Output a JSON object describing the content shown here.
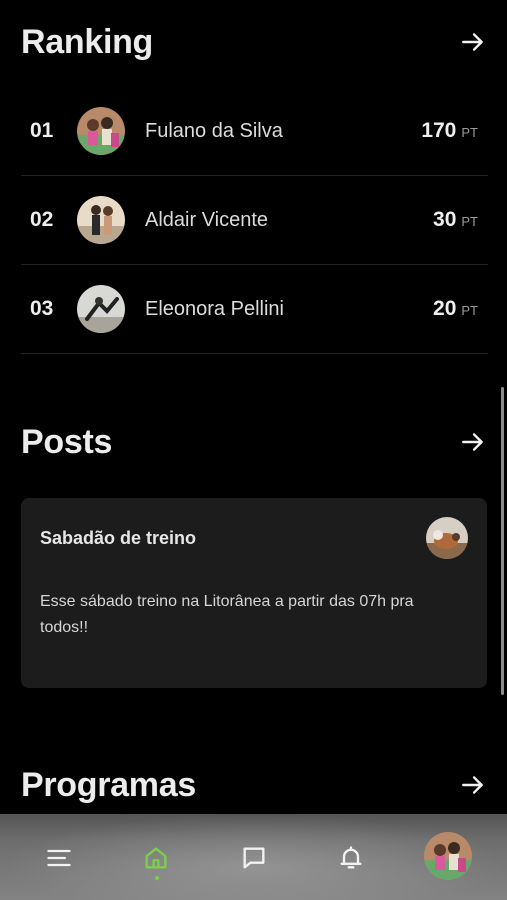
{
  "ranking": {
    "title": "Ranking",
    "unit": "PT",
    "entries": [
      {
        "position": "01",
        "name": "Fulano da Silva",
        "points": "170",
        "avatar": "photo-group-avatar"
      },
      {
        "position": "02",
        "name": "Aldair Vicente",
        "points": "30",
        "avatar": "photo-duo-avatar"
      },
      {
        "position": "03",
        "name": "Eleonora Pellini",
        "points": "20",
        "avatar": "photo-yoga-avatar"
      }
    ]
  },
  "posts": {
    "title": "Posts",
    "items": [
      {
        "title": "Sabadão de treino",
        "body": "Esse sábado treino na Litorânea a partir das 07h pra todos!!",
        "avatar": "photo-pet-avatar"
      }
    ]
  },
  "programs": {
    "title": "Programas"
  },
  "nav": {
    "items": [
      {
        "name": "menu",
        "icon": "menu-icon"
      },
      {
        "name": "home",
        "icon": "home-icon",
        "active": true
      },
      {
        "name": "chat",
        "icon": "chat-icon"
      },
      {
        "name": "notifications",
        "icon": "bell-icon"
      },
      {
        "name": "profile",
        "icon": "profile-avatar"
      }
    ],
    "active_color": "#7bd04a"
  }
}
